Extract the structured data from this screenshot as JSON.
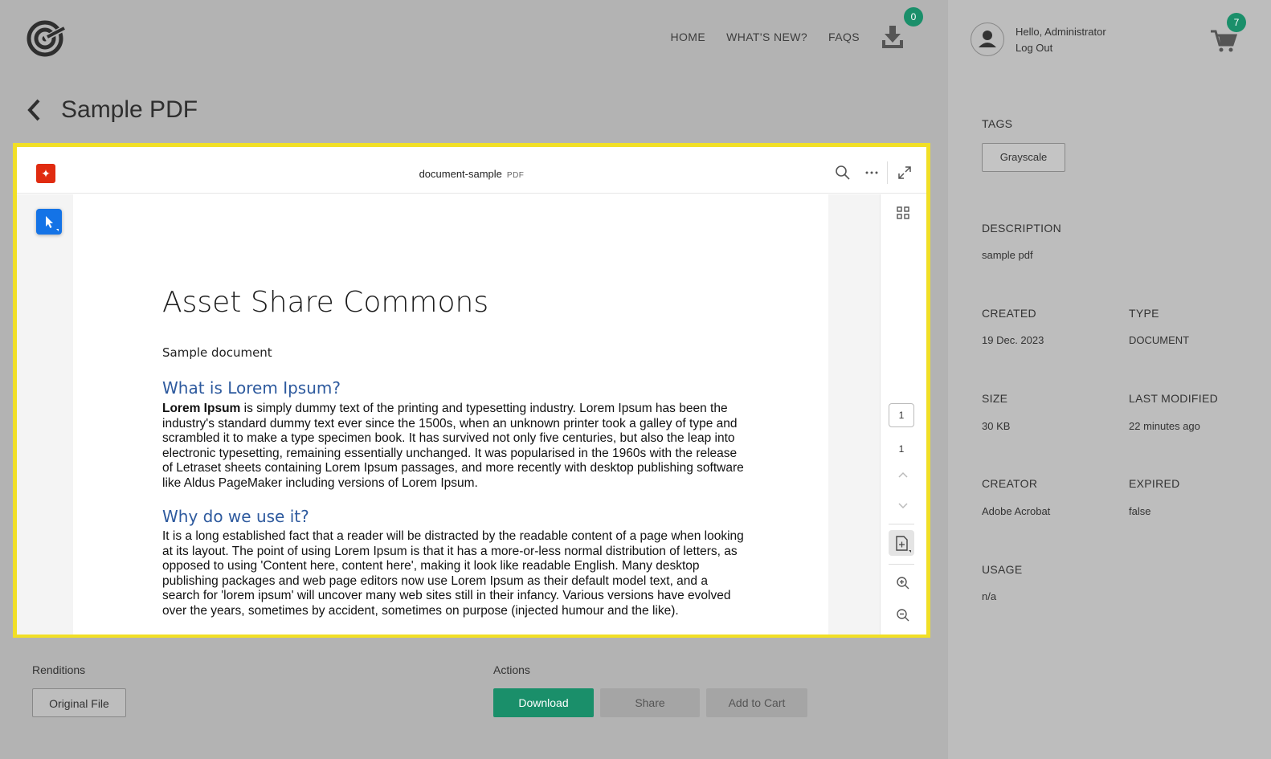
{
  "nav": {
    "home": "HOME",
    "whats_new": "WHAT'S NEW?",
    "faqs": "FAQS",
    "download_count": "0"
  },
  "page": {
    "title": "Sample PDF"
  },
  "viewer": {
    "filename": "document-sample",
    "file_ext": "PDF",
    "current_page": "1",
    "page_count": "1",
    "document": {
      "title": "Asset Share Commons",
      "subtitle": "Sample document",
      "h2_1": "What is Lorem Ipsum?",
      "p1_bold": "Lorem Ipsum",
      "p1_rest": " is simply dummy text of the printing and typesetting industry. Lorem Ipsum has been the industry's standard dummy text ever since the 1500s, when an unknown printer took a galley of type and scrambled it to make a type specimen book. It has survived not only five centuries, but also the leap into electronic typesetting, remaining essentially unchanged. It was popularised in the 1960s with the release of Letraset sheets containing Lorem Ipsum passages, and more recently with desktop publishing software like Aldus PageMaker including versions of Lorem Ipsum.",
      "h2_2": "Why do we use it?",
      "p2": "It is a long established fact that a reader will be distracted by the readable content of a page when looking at its layout. The point of using Lorem Ipsum is that it has a more-or-less normal distribution of letters, as opposed to using 'Content here, content here', making it look like readable English. Many desktop publishing packages and web page editors now use Lorem Ipsum as their default model text, and a search for 'lorem ipsum' will uncover many web sites still in their infancy. Various versions have evolved over the years, sometimes by accident, sometimes on purpose (injected humour and the like)."
    }
  },
  "renditions": {
    "label": "Renditions",
    "original": "Original File"
  },
  "actions": {
    "label": "Actions",
    "download": "Download",
    "share": "Share",
    "add_to_cart": "Add to Cart"
  },
  "user": {
    "greeting": "Hello, Administrator",
    "logout": "Log Out",
    "cart_count": "7"
  },
  "meta": {
    "tags_label": "TAGS",
    "tag": "Grayscale",
    "description_label": "DESCRIPTION",
    "description": "sample pdf",
    "created_label": "CREATED",
    "created": "19 Dec. 2023",
    "type_label": "TYPE",
    "type": "DOCUMENT",
    "size_label": "SIZE",
    "size": "30 KB",
    "modified_label": "LAST MODIFIED",
    "modified": "22 minutes ago",
    "creator_label": "CREATOR",
    "creator": "Adobe Acrobat",
    "expired_label": "EXPIRED",
    "expired": "false",
    "usage_label": "USAGE",
    "usage": "n/a"
  },
  "colors": {
    "accent": "#1a8f6a",
    "highlight": "#f1df26",
    "pdf_red": "#e02b10",
    "heading_blue": "#2e5a9e"
  }
}
